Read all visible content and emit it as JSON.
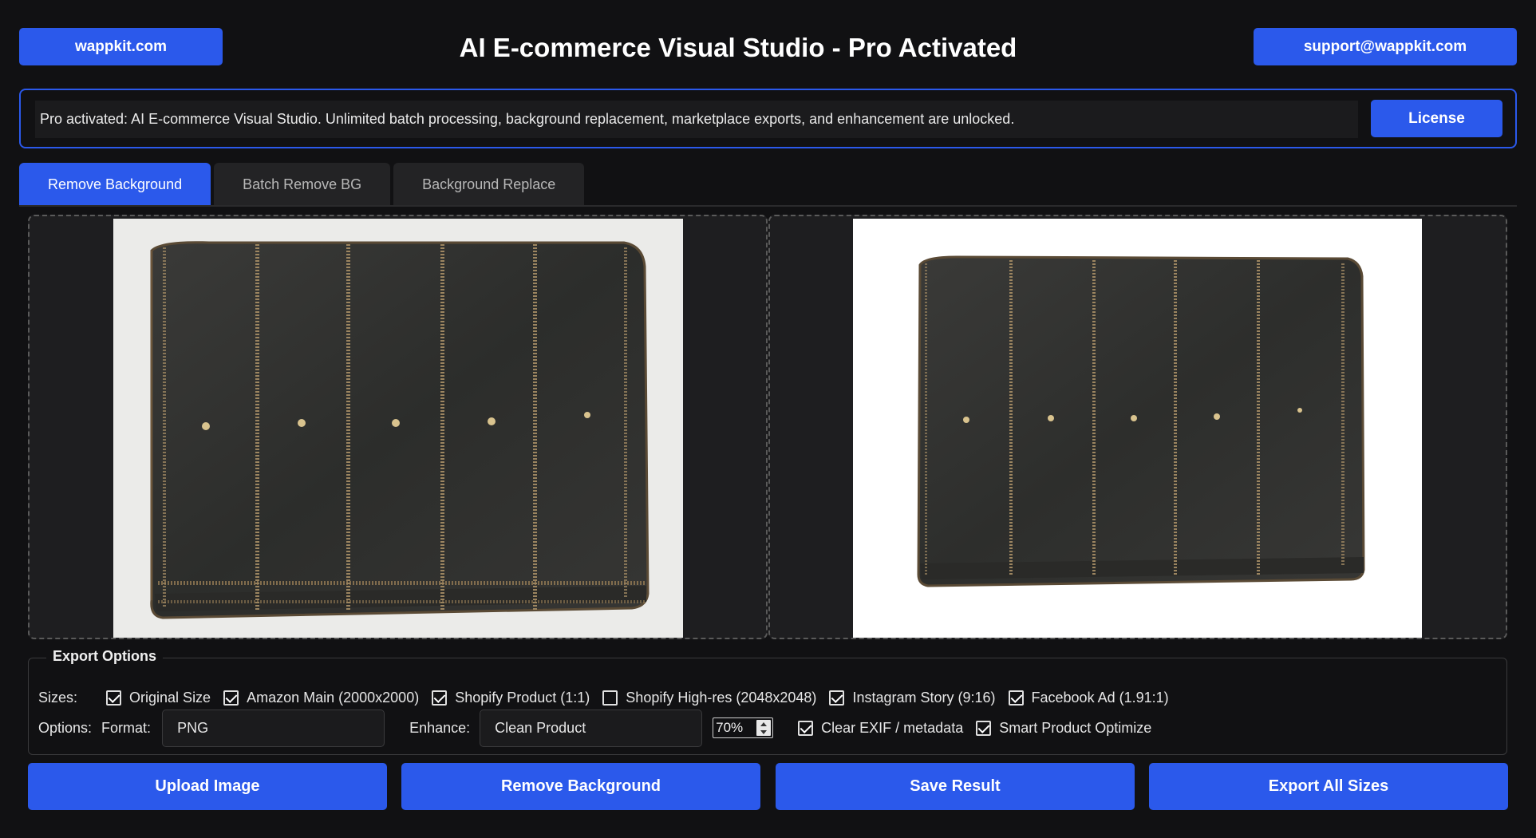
{
  "header": {
    "site_button": "wappkit.com",
    "title": "AI E-commerce Visual Studio - Pro Activated",
    "support_button": "support@wappkit.com"
  },
  "banner": {
    "text": "Pro activated: AI E-commerce Visual Studio. Unlimited batch processing, background replacement, marketplace exports, and enhancement are unlocked.",
    "license_button": "License",
    "border_color": "#2b59eb"
  },
  "tabs": [
    {
      "label": "Remove Background",
      "active": true
    },
    {
      "label": "Batch Remove BG",
      "active": false
    },
    {
      "label": "Background Replace",
      "active": false
    }
  ],
  "preview": {
    "original_image": "worn black leather wallet with gold stitching on light grey background",
    "result_image": "same wallet with background removed on white"
  },
  "export_options": {
    "legend": "Export Options",
    "sizes_label": "Sizes:",
    "sizes": [
      {
        "label": "Original Size",
        "checked": true
      },
      {
        "label": "Amazon Main (2000x2000)",
        "checked": true
      },
      {
        "label": "Shopify Product (1:1)",
        "checked": true
      },
      {
        "label": "Shopify High-res (2048x2048)",
        "checked": false
      },
      {
        "label": "Instagram Story (9:16)",
        "checked": true
      },
      {
        "label": "Facebook Ad (1.91:1)",
        "checked": true
      }
    ],
    "options_label": "Options:",
    "format_label": "Format:",
    "format_value": "PNG",
    "enhance_label": "Enhance:",
    "enhance_value": "Clean Product",
    "enhance_strength": "70%",
    "flags": [
      {
        "label": "Clear EXIF / metadata",
        "checked": true
      },
      {
        "label": "Smart Product Optimize",
        "checked": true
      }
    ]
  },
  "actions": {
    "upload": "Upload Image",
    "remove": "Remove Background",
    "save": "Save Result",
    "export_all": "Export All Sizes"
  },
  "colors": {
    "accent": "#2b59eb",
    "background": "#111113",
    "panel": "#1e1e20"
  }
}
